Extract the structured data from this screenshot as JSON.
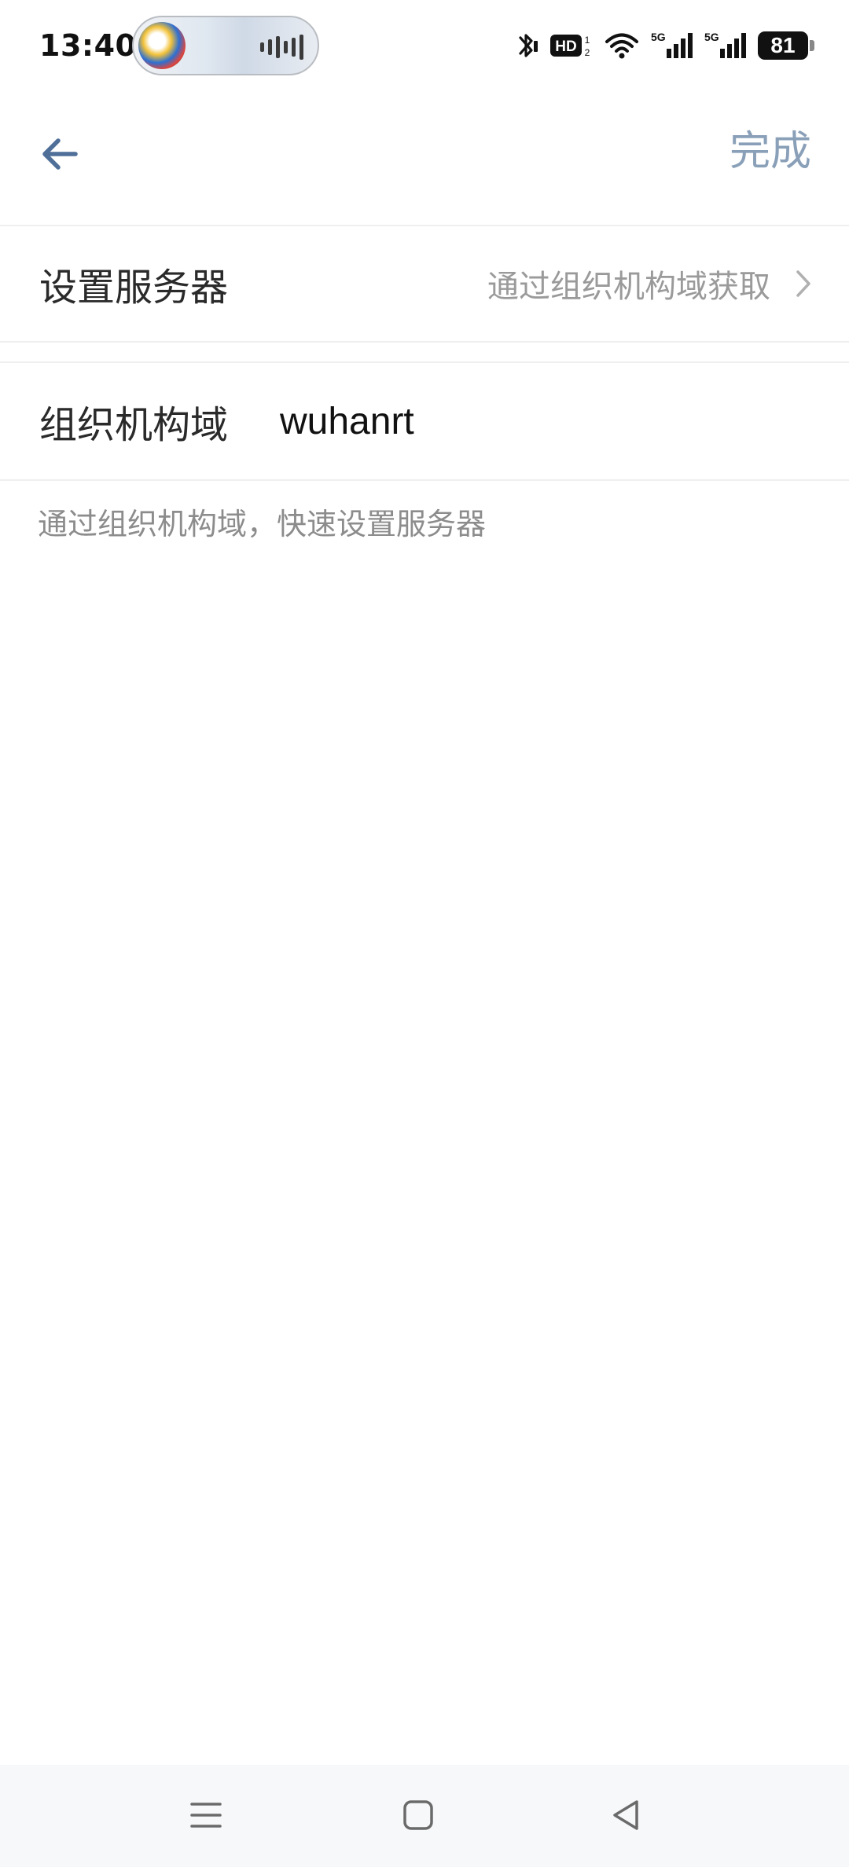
{
  "status_bar": {
    "time": "13:40",
    "battery_level": "81",
    "network_labels": [
      "5G",
      "5G"
    ],
    "icons": [
      "bluetooth-icon",
      "hd-icon",
      "wifi-icon",
      "signal-5g-icon",
      "signal-5g-icon",
      "battery-icon"
    ]
  },
  "header": {
    "back_icon": "arrow-left-icon",
    "done_label": "完成"
  },
  "server_row": {
    "label": "设置服务器",
    "value": "通过组织机构域获取",
    "chevron_icon": "chevron-right-icon"
  },
  "domain_row": {
    "label": "组织机构域",
    "value": "wuhanrt"
  },
  "hint": "通过组织机构域，快速设置服务器",
  "nav_bar": {
    "icons": [
      "menu-icon",
      "home-icon",
      "back-icon"
    ]
  },
  "colors": {
    "accent": "#4f6f99",
    "done_text": "#8aa0b8",
    "secondary_text": "#9a9a9a",
    "divider": "#efefef"
  }
}
